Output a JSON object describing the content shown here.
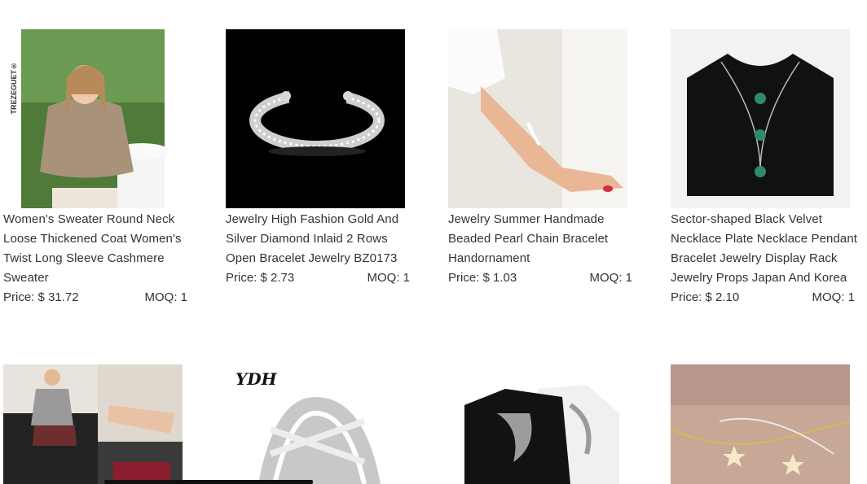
{
  "products": [
    {
      "title": "Women's Sweater Round Neck Loose Thickened Coat Women's Twist Long Sleeve Cashmere Sweater",
      "price": "Price: $ 31.72",
      "moq": "MOQ: 1",
      "brand_text": "TREZEGUET®"
    },
    {
      "title": "Jewelry High Fashion Gold And Silver Diamond Inlaid 2 Rows Open Bracelet Jewelry BZ0173",
      "price": "Price: $ 2.73",
      "moq": "MOQ: 1"
    },
    {
      "title": "Jewelry Summer Handmade Beaded Pearl Chain Bracelet Handornament",
      "price": "Price: $ 1.03",
      "moq": "MOQ: 1"
    },
    {
      "title": "Sector-shaped Black Velvet Necklace Plate Necklace Pendant Bracelet Jewelry Display Rack Jewelry Props Japan And Korea",
      "price": "Price: $ 2.10",
      "moq": "MOQ: 1"
    }
  ],
  "row2": [
    {
      "image": "women-shorts-photo"
    },
    {
      "image": "silver-ring-photo",
      "logo_text": "YDH"
    },
    {
      "image": "tattoo-shirts-photo"
    },
    {
      "image": "star-bracelet-photo"
    }
  ]
}
